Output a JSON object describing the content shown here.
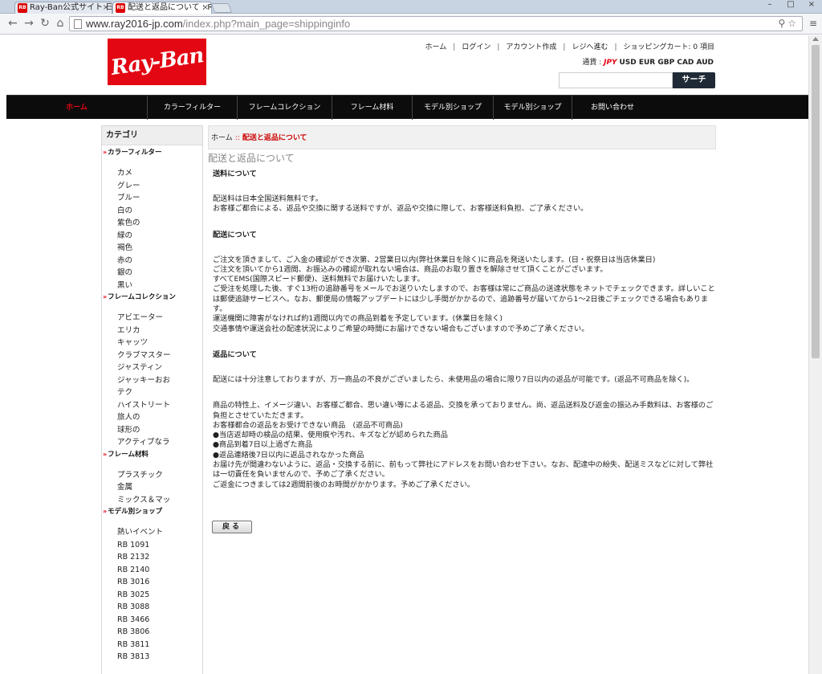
{
  "browser": {
    "tabs": [
      {
        "title": "Ray-Ban公式サイト 日本"
      },
      {
        "title": "配送と返品について : Ra"
      }
    ],
    "url_host": "www.ray2016-jp.com",
    "url_path": "/index.php?main_page=shippinginfo",
    "window_controls": [
      "–",
      "□",
      "×"
    ]
  },
  "header": {
    "logo_text": "Ray-Ban",
    "top_links": [
      "ホーム",
      "ログイン",
      "アカウント作成",
      "レジへ進む",
      "ショッピングカート: 0 項目"
    ],
    "currency_label": "通貨 :",
    "currency_active": "JPY",
    "currencies": "USD EUR GBP CAD AUD",
    "search_button": "サーチ"
  },
  "main_nav": [
    "ホーム",
    "カラーフィルター",
    "フレームコレクション",
    "フレーム材料",
    "モデル別ショップ",
    "モデル別ショップ",
    "お問い合わせ"
  ],
  "sidebar": {
    "heading": "カテゴリ",
    "groups": [
      {
        "title": "カラーフィルター",
        "items": [
          "カメ",
          "グレー",
          "ブルー",
          "白の",
          "紫色の",
          "緑の",
          "褐色",
          "赤の",
          "銀の",
          "黒い"
        ]
      },
      {
        "title": "フレームコレクション",
        "items": [
          "アビエーター",
          "エリカ",
          "キャッツ",
          "クラブマスター",
          "ジャスティン",
          "ジャッキーおお",
          "テク",
          "ハイストリート",
          "旅人の",
          "球形の",
          "アクティブなラ"
        ]
      },
      {
        "title": "フレーム材料",
        "items": [
          "プラスチック",
          "金属",
          "ミックス＆マッ"
        ]
      },
      {
        "title": "モデル別ショップ",
        "items": [
          "熱いイベント",
          "RB 1091",
          "RB 2132",
          "RB 2140",
          "RB 3016",
          "RB 3025",
          "RB 3088",
          "RB 3466",
          "RB 3806",
          "RB 3811",
          "RB 3813"
        ]
      }
    ]
  },
  "content": {
    "breadcrumb_home": "ホーム",
    "breadcrumb_sep": "::",
    "breadcrumb_current": "配送と返品について",
    "page_title": "配送と返品について",
    "sections": [
      {
        "heading": "送料について",
        "paragraphs": [
          "配送料は日本全国送料無料です。\nお客様ご都合による、返品や交換に関する送料ですが、返品や交換に際して、お客様送料負担、ご了承ください。"
        ]
      },
      {
        "heading": "配送について",
        "paragraphs": [
          "ご注文を頂きまして、ご入金の確認ができ次第、2営業日以内(弊社休業日を除く)に商品を発送いたします。(日・祝祭日は当店休業日)\nご注文を頂いてから1週間、お振込みの確認が取れない場合は、商品のお取り置きを解除させて頂くことがございます。\nすべてEMS(国際スピード郵便)、送料無料でお届けいたします。\nご受注を処理した後、すぐ13桁の追跡番号をメールでお送りいたしますので、お客様は常にご商品の送達状態をネットでチェックできます。詳しいことは郵便追跡サービスへ。なお、郵便局の情報アップデートには少し手間がかかるので、追跡番号が届いてから1〜2日後ごチェックできる場合もあります。\n運送機関に障害がなければ約1週間以内での商品到着を予定しています。(休業日を除く)\n交通事情や運送会社の配達状況によりご希望の時間にお届けできない場合もございますので予めご了承ください。"
        ]
      },
      {
        "heading": "返品について",
        "paragraphs": [
          "配送には十分注意しておりますが、万一商品の不良がございましたら、未使用品の場合に限り7日以内の返品が可能です。(返品不可商品を除く)。",
          "商品の特性上、イメージ違い、お客様ご都合、思い違い等による返品、交換を承っておりません。尚、返品送料及び返金の振込み手数料は、お客様のご負担とさせていただきます。\nお客様都合の返品をお受けできない商品　(返品不可商品)\n●当店返却時の検品の結果、使用痕や汚れ、キズなどが認められた商品\n●商品到着7日以上過ぎた商品\n●返品連絡後7日以内に返品されなかった商品\nお届け先が間違わないように、返品・交換する前に、前もって弊社にアドレスをお問い合わせ下さい。なお、配達中の紛失、配送ミスなどに対して弊社は一切責任を負いませんので、予めご了承ください。\nご返金につきましては2週間前後のお時間がかかります。予めご了承ください。"
        ]
      }
    ],
    "back_button": "戻る"
  }
}
